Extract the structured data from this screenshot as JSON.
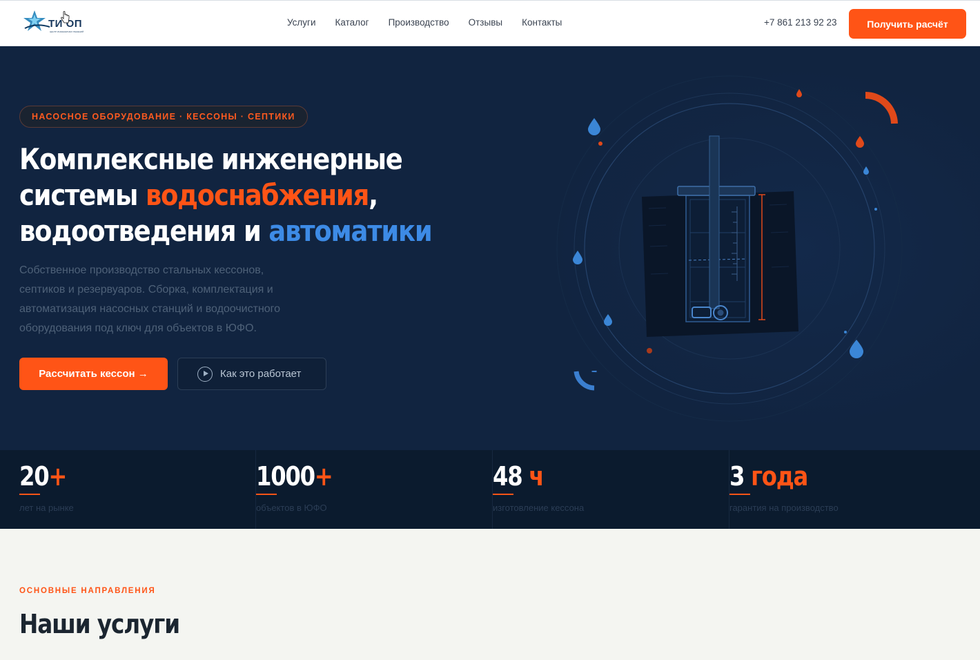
{
  "header": {
    "logo_text": "ТИ ОП",
    "logo_sub": "ЦЕНТР ИНЖЕНЕРНЫХ РЕШЕНИЙ",
    "nav": [
      "Услуги",
      "Каталог",
      "Производство",
      "Отзывы",
      "Контакты"
    ],
    "phone": "+7 861 213 92 23",
    "cta_label": "Получить расчёт"
  },
  "hero": {
    "pill": "НАСОСНОЕ ОБОРУДОВАНИЕ · КЕССОНЫ · СЕПТИКИ",
    "headline": {
      "line1": "Комплексные инженерные",
      "line2_start": "системы ",
      "line2_accent": "водоснабжения",
      "line2_end": ",",
      "line3_start": "водоотведения и ",
      "line3_accent": "автоматики"
    },
    "lead": "Собственное производство стальных кессонов, септиков и резервуаров. Сборка, комплектация и автоматизация насосных станций и водоочистного оборудования под ключ для объектов в ЮФО.",
    "primary_button": "Рассчитать кессон →",
    "secondary_button": "Как это работает"
  },
  "stats": [
    {
      "value": "20",
      "suffix": "+",
      "label": "лет на рынке"
    },
    {
      "value": "1000",
      "suffix": "+",
      "label": "объектов в ЮФО"
    },
    {
      "value": "48",
      "suffix": " ч",
      "label": "изготовление кессона"
    },
    {
      "value": "3",
      "suffix": " года",
      "label": "гарантия на производство"
    }
  ],
  "services": {
    "kicker": "ОСНОВНЫЕ НАПРАВЛЕНИЯ",
    "title": "Наши услуги"
  },
  "colors": {
    "accent_orange": "#ff5416",
    "accent_blue": "#3d8be6",
    "hero_bg": "#112440",
    "stats_bg": "#0b1b2e",
    "page_bg": "#f4f5f1"
  },
  "icons": [
    "logo-star-icon",
    "cursor-hand-icon",
    "play-icon",
    "water-drop-icon",
    "caisson-illustration"
  ]
}
